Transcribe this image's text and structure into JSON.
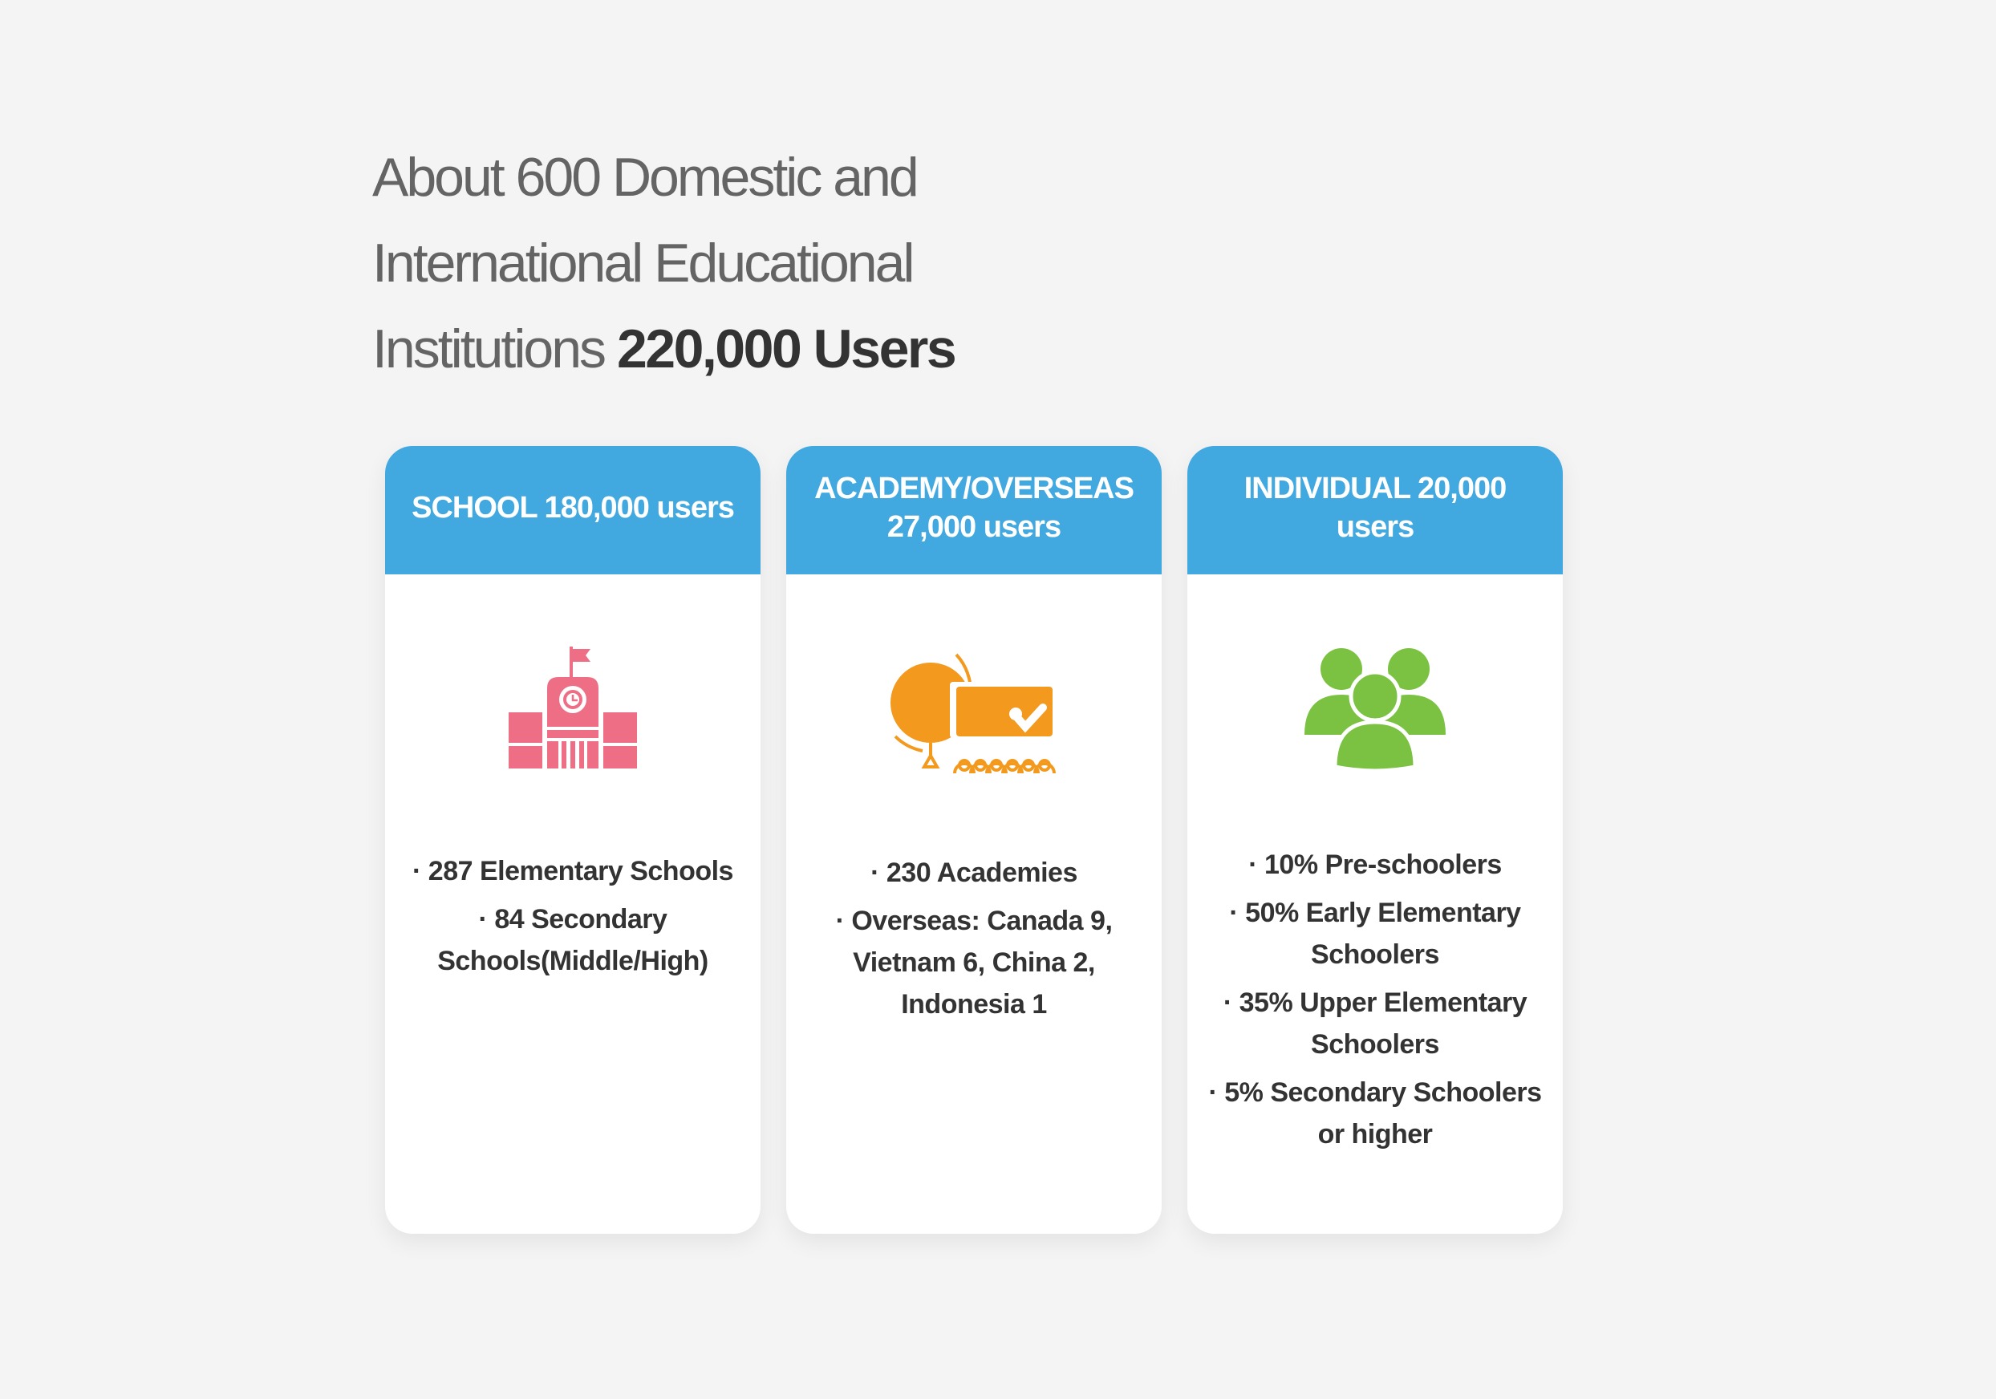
{
  "headline": {
    "line1": "About 600 Domestic and",
    "line2": "International Educational",
    "line3_prefix": "Institutions ",
    "line3_strong": "220,000 Users"
  },
  "colors": {
    "background": "#f4f4f4",
    "card_header": "#41a8e0",
    "school_icon": "#ee6e85",
    "academy_icon": "#f39a1e",
    "individual_icon": "#7cc242"
  },
  "cards": [
    {
      "title": "SCHOOL 180,000 users",
      "icon": "school-building-icon",
      "items": [
        "· 287 Elementary Schools",
        "· 84 Secondary Schools(Middle/High)"
      ]
    },
    {
      "title": "ACADEMY/OVERSEAS 27,000 users",
      "icon": "academy-classroom-icon",
      "items": [
        "· 230 Academies",
        "· Overseas: Canada 9, Vietnam 6, China 2, Indonesia 1"
      ]
    },
    {
      "title": "INDIVIDUAL 20,000 users",
      "icon": "people-group-icon",
      "items": [
        "· 10% Pre-schoolers",
        "· 50% Early Elementary Schoolers",
        "· 35% Upper Elementary Schoolers",
        "· 5% Secondary Schoolers or higher"
      ]
    }
  ]
}
